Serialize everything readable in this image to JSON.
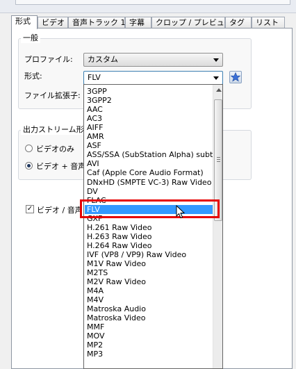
{
  "tabs": [
    "形式",
    "ビデオ",
    "音声トラック 1",
    "字幕",
    "クロップ / プレビュー",
    "タグ",
    "リスト"
  ],
  "general": {
    "group_title": "一般",
    "profile_label": "プロファイル:",
    "profile_value": "カスタム",
    "format_label": "形式:",
    "format_value": "FLV",
    "extension_label": "ファイル拡張子:"
  },
  "output_stream": {
    "group_title": "出力ストリーム形式",
    "video_only": "ビデオのみ",
    "video_audio": "ビデオ + 音声",
    "selected": "video_audio"
  },
  "checkbox": {
    "label": "ビデオ / 音声",
    "checked": true
  },
  "dropdown": {
    "selected": "FLV",
    "options": [
      "3GPP",
      "3GPP2",
      "AAC",
      "AC3",
      "AIFF",
      "AMR",
      "ASF",
      "ASS/SSA (SubStation Alpha) subtitle",
      "AVI",
      "Caf (Apple Core Audio Format)",
      "DNxHD (SMPTE VC-3) Raw Video",
      "DV",
      "FLAC",
      "FLV",
      "GXF",
      "H.261 Raw Video",
      "H.263 Raw Video",
      "H.264 Raw Video",
      "IVF (VP8 / VP9) Raw Video",
      "M1V Raw Video",
      "M2TS",
      "M2V Raw Video",
      "M4A",
      "M4V",
      "Matroska Audio",
      "Matroska Video",
      "MMF",
      "MOV",
      "MP2",
      "MP3"
    ]
  },
  "icons": {
    "favorite": "star-icon",
    "combo_arrow": "chevron-down-icon",
    "cursor": "mouse-pointer-icon"
  },
  "colors": {
    "selection": "#3399ff",
    "highlight_box": "#e60000",
    "star": "#3b6fd6"
  }
}
